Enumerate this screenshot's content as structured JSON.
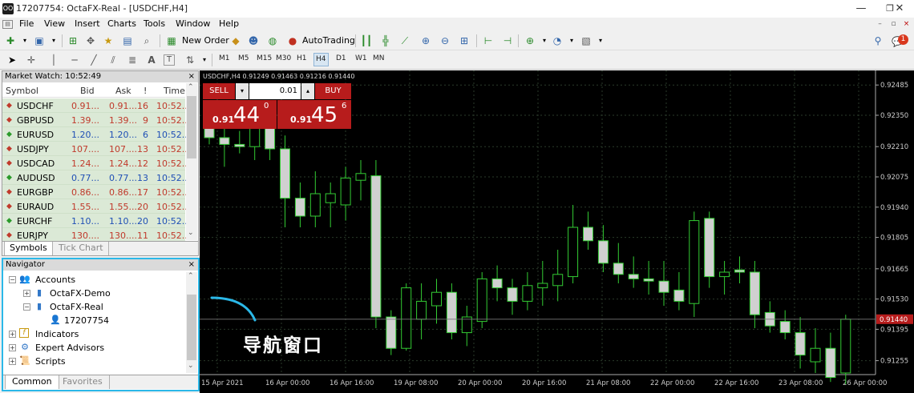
{
  "window": {
    "title": "17207754: OctaFX-Real - [USDCHF,H4]",
    "app_icon_text": "OO"
  },
  "menu": [
    "File",
    "View",
    "Insert",
    "Charts",
    "Tools",
    "Window",
    "Help"
  ],
  "toolbar": {
    "new_order_label": "New Order",
    "autotrading_label": "AutoTrading",
    "notification_count": "1"
  },
  "timeframes": [
    "M1",
    "M5",
    "M15",
    "M30",
    "H1",
    "H4",
    "D1",
    "W1",
    "MN"
  ],
  "active_timeframe": "H4",
  "market_watch": {
    "title": "Market Watch: 10:52:49",
    "columns": [
      "Symbol",
      "Bid",
      "Ask",
      "!",
      "Time"
    ],
    "rows": [
      {
        "symbol": "USDCHF",
        "bid": "0.91...",
        "ask": "0.91...",
        "spread": "16",
        "time": "10:52...",
        "dir": "down"
      },
      {
        "symbol": "GBPUSD",
        "bid": "1.39...",
        "ask": "1.39...",
        "spread": "9",
        "time": "10:52...",
        "dir": "down"
      },
      {
        "symbol": "EURUSD",
        "bid": "1.20...",
        "ask": "1.20...",
        "spread": "6",
        "time": "10:52...",
        "dir": "up"
      },
      {
        "symbol": "USDJPY",
        "bid": "107....",
        "ask": "107....",
        "spread": "13",
        "time": "10:52...",
        "dir": "down"
      },
      {
        "symbol": "USDCAD",
        "bid": "1.24...",
        "ask": "1.24...",
        "spread": "12",
        "time": "10:52...",
        "dir": "down"
      },
      {
        "symbol": "AUDUSD",
        "bid": "0.77...",
        "ask": "0.77...",
        "spread": "13",
        "time": "10:52...",
        "dir": "up"
      },
      {
        "symbol": "EURGBP",
        "bid": "0.86...",
        "ask": "0.86...",
        "spread": "17",
        "time": "10:52...",
        "dir": "down"
      },
      {
        "symbol": "EURAUD",
        "bid": "1.55...",
        "ask": "1.55...",
        "spread": "20",
        "time": "10:52...",
        "dir": "down"
      },
      {
        "symbol": "EURCHF",
        "bid": "1.10...",
        "ask": "1.10...",
        "spread": "20",
        "time": "10:52...",
        "dir": "up"
      },
      {
        "symbol": "EURJPY",
        "bid": "130....",
        "ask": "130....",
        "spread": "11",
        "time": "10:52...",
        "dir": "down"
      }
    ],
    "tabs": [
      "Symbols",
      "Tick Chart"
    ]
  },
  "navigator": {
    "title": "Navigator",
    "accounts_label": "Accounts",
    "account_demo": "OctaFX-Demo",
    "account_real": "OctaFX-Real",
    "account_number": "17207754",
    "indicators_label": "Indicators",
    "experts_label": "Expert Advisors",
    "scripts_label": "Scripts",
    "tabs": [
      "Common",
      "Favorites"
    ]
  },
  "chart": {
    "info": "USDCHF,H4  0.91249 0.91463 0.91216 0.91440",
    "sell_label": "SELL",
    "buy_label": "BUY",
    "lot_value": "0.01",
    "sell_prefix": "0.91",
    "sell_main": "44",
    "sell_sup": "0",
    "buy_prefix": "0.91",
    "buy_main": "45",
    "buy_sup": "6",
    "current_price": "0.91440",
    "price_labels": [
      "0.92485",
      "0.92350",
      "0.92210",
      "0.92075",
      "0.91940",
      "0.91805",
      "0.91665",
      "0.91530",
      "0.91395",
      "0.91255"
    ],
    "time_labels": [
      "15 Apr 2021",
      "16 Apr 00:00",
      "16 Apr 16:00",
      "19 Apr 08:00",
      "20 Apr 00:00",
      "20 Apr 16:00",
      "21 Apr 08:00",
      "22 Apr 00:00",
      "22 Apr 16:00",
      "23 Apr 08:00",
      "26 Apr 00:00"
    ],
    "colors": {
      "background": "#000000",
      "grid": "#2a3a2a",
      "bull_body": "#000000",
      "bear_body": "#d0d0d0",
      "wick": "#33cc33",
      "price_highlight": "#b71c1c"
    }
  },
  "annotation": {
    "text": "导航窗口",
    "color": "#2bb8e8"
  },
  "chart_data": {
    "type": "candlestick",
    "symbol": "USDCHF",
    "timeframe": "H4",
    "ylim": [
      0.912,
      0.9255
    ],
    "y_ticks": [
      0.92485,
      0.9235,
      0.9221,
      0.92075,
      0.9194,
      0.91805,
      0.91665,
      0.9153,
      0.91395,
      0.91255
    ],
    "x_tick_labels": [
      "15 Apr 2021",
      "16 Apr 00:00",
      "16 Apr 16:00",
      "19 Apr 08:00",
      "20 Apr 00:00",
      "20 Apr 16:00",
      "21 Apr 08:00",
      "22 Apr 00:00",
      "22 Apr 16:00",
      "23 Apr 08:00",
      "26 Apr 00:00"
    ],
    "candles": [
      {
        "o": 0.923,
        "h": 0.9238,
        "l": 0.9222,
        "c": 0.9225
      },
      {
        "o": 0.9225,
        "h": 0.9232,
        "l": 0.9212,
        "c": 0.9222
      },
      {
        "o": 0.9222,
        "h": 0.9228,
        "l": 0.9218,
        "c": 0.9221
      },
      {
        "o": 0.9221,
        "h": 0.9238,
        "l": 0.9215,
        "c": 0.9232
      },
      {
        "o": 0.9232,
        "h": 0.924,
        "l": 0.9215,
        "c": 0.922
      },
      {
        "o": 0.922,
        "h": 0.9226,
        "l": 0.9185,
        "c": 0.9198
      },
      {
        "o": 0.9198,
        "h": 0.9205,
        "l": 0.9185,
        "c": 0.919
      },
      {
        "o": 0.919,
        "h": 0.921,
        "l": 0.9185,
        "c": 0.92
      },
      {
        "o": 0.9196,
        "h": 0.9205,
        "l": 0.9185,
        "c": 0.92
      },
      {
        "o": 0.9195,
        "h": 0.9212,
        "l": 0.9188,
        "c": 0.9207
      },
      {
        "o": 0.9206,
        "h": 0.9215,
        "l": 0.9197,
        "c": 0.9209
      },
      {
        "o": 0.9208,
        "h": 0.9215,
        "l": 0.914,
        "c": 0.9145
      },
      {
        "o": 0.9145,
        "h": 0.9148,
        "l": 0.9128,
        "c": 0.9131
      },
      {
        "o": 0.9131,
        "h": 0.916,
        "l": 0.913,
        "c": 0.9158
      },
      {
        "o": 0.9144,
        "h": 0.916,
        "l": 0.9135,
        "c": 0.9152
      },
      {
        "o": 0.915,
        "h": 0.9162,
        "l": 0.9142,
        "c": 0.9156
      },
      {
        "o": 0.9156,
        "h": 0.916,
        "l": 0.9135,
        "c": 0.9138
      },
      {
        "o": 0.9138,
        "h": 0.915,
        "l": 0.9132,
        "c": 0.9145
      },
      {
        "o": 0.9143,
        "h": 0.9165,
        "l": 0.914,
        "c": 0.9162
      },
      {
        "o": 0.9162,
        "h": 0.9168,
        "l": 0.9152,
        "c": 0.9158
      },
      {
        "o": 0.9158,
        "h": 0.9162,
        "l": 0.9146,
        "c": 0.9152
      },
      {
        "o": 0.9152,
        "h": 0.9165,
        "l": 0.9148,
        "c": 0.9159
      },
      {
        "o": 0.9158,
        "h": 0.917,
        "l": 0.915,
        "c": 0.916
      },
      {
        "o": 0.9159,
        "h": 0.9175,
        "l": 0.9152,
        "c": 0.9164
      },
      {
        "o": 0.9163,
        "h": 0.9195,
        "l": 0.916,
        "c": 0.9185
      },
      {
        "o": 0.9185,
        "h": 0.9192,
        "l": 0.9175,
        "c": 0.9179
      },
      {
        "o": 0.9179,
        "h": 0.9186,
        "l": 0.9165,
        "c": 0.9169
      },
      {
        "o": 0.9169,
        "h": 0.9178,
        "l": 0.916,
        "c": 0.9164
      },
      {
        "o": 0.9164,
        "h": 0.9172,
        "l": 0.9158,
        "c": 0.9162
      },
      {
        "o": 0.9162,
        "h": 0.917,
        "l": 0.9155,
        "c": 0.9161
      },
      {
        "o": 0.9161,
        "h": 0.917,
        "l": 0.915,
        "c": 0.9156
      },
      {
        "o": 0.9157,
        "h": 0.9165,
        "l": 0.9148,
        "c": 0.9152
      },
      {
        "o": 0.9151,
        "h": 0.9192,
        "l": 0.9145,
        "c": 0.9188
      },
      {
        "o": 0.9189,
        "h": 0.9192,
        "l": 0.9158,
        "c": 0.9163
      },
      {
        "o": 0.9163,
        "h": 0.917,
        "l": 0.9155,
        "c": 0.9165
      },
      {
        "o": 0.9166,
        "h": 0.9172,
        "l": 0.916,
        "c": 0.9165
      },
      {
        "o": 0.9165,
        "h": 0.917,
        "l": 0.914,
        "c": 0.9146
      },
      {
        "o": 0.9147,
        "h": 0.9152,
        "l": 0.9138,
        "c": 0.9141
      },
      {
        "o": 0.9143,
        "h": 0.9148,
        "l": 0.9135,
        "c": 0.9138
      },
      {
        "o": 0.9138,
        "h": 0.9145,
        "l": 0.9122,
        "c": 0.9128
      },
      {
        "o": 0.9125,
        "h": 0.914,
        "l": 0.912,
        "c": 0.9131
      },
      {
        "o": 0.9131,
        "h": 0.9138,
        "l": 0.9116,
        "c": 0.9118
      },
      {
        "o": 0.912,
        "h": 0.9146,
        "l": 0.9115,
        "c": 0.9144
      }
    ]
  }
}
